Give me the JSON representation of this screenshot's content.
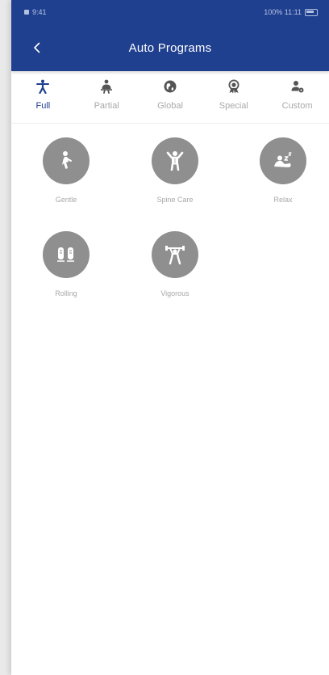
{
  "status_bar": {
    "left_text": "9:41",
    "right_text": "100% 11:11"
  },
  "header": {
    "title": "Auto Programs",
    "back_icon": "chevron-left-icon"
  },
  "tabs": [
    {
      "label": "Full",
      "icon": "full-body-icon",
      "active": true
    },
    {
      "label": "Partial",
      "icon": "partial-body-icon",
      "active": false
    },
    {
      "label": "Global",
      "icon": "globe-icon",
      "active": false
    },
    {
      "label": "Special",
      "icon": "award-ribbon-icon",
      "active": false
    },
    {
      "label": "Custom",
      "icon": "user-settings-icon",
      "active": false
    }
  ],
  "programs": [
    {
      "label": "Gentle",
      "icon": "gentle-person-icon"
    },
    {
      "label": "Spine Care",
      "icon": "spine-care-icon"
    },
    {
      "label": "Relax",
      "icon": "relax-sleep-icon"
    },
    {
      "label": "Rolling",
      "icon": "rolling-feet-icon"
    },
    {
      "label": "Vigorous",
      "icon": "weightlifter-icon"
    }
  ],
  "colors": {
    "primary": "#1f3f8f",
    "tab_inactive": "#a9a9a9",
    "program_circle": "#8f8f8f"
  }
}
